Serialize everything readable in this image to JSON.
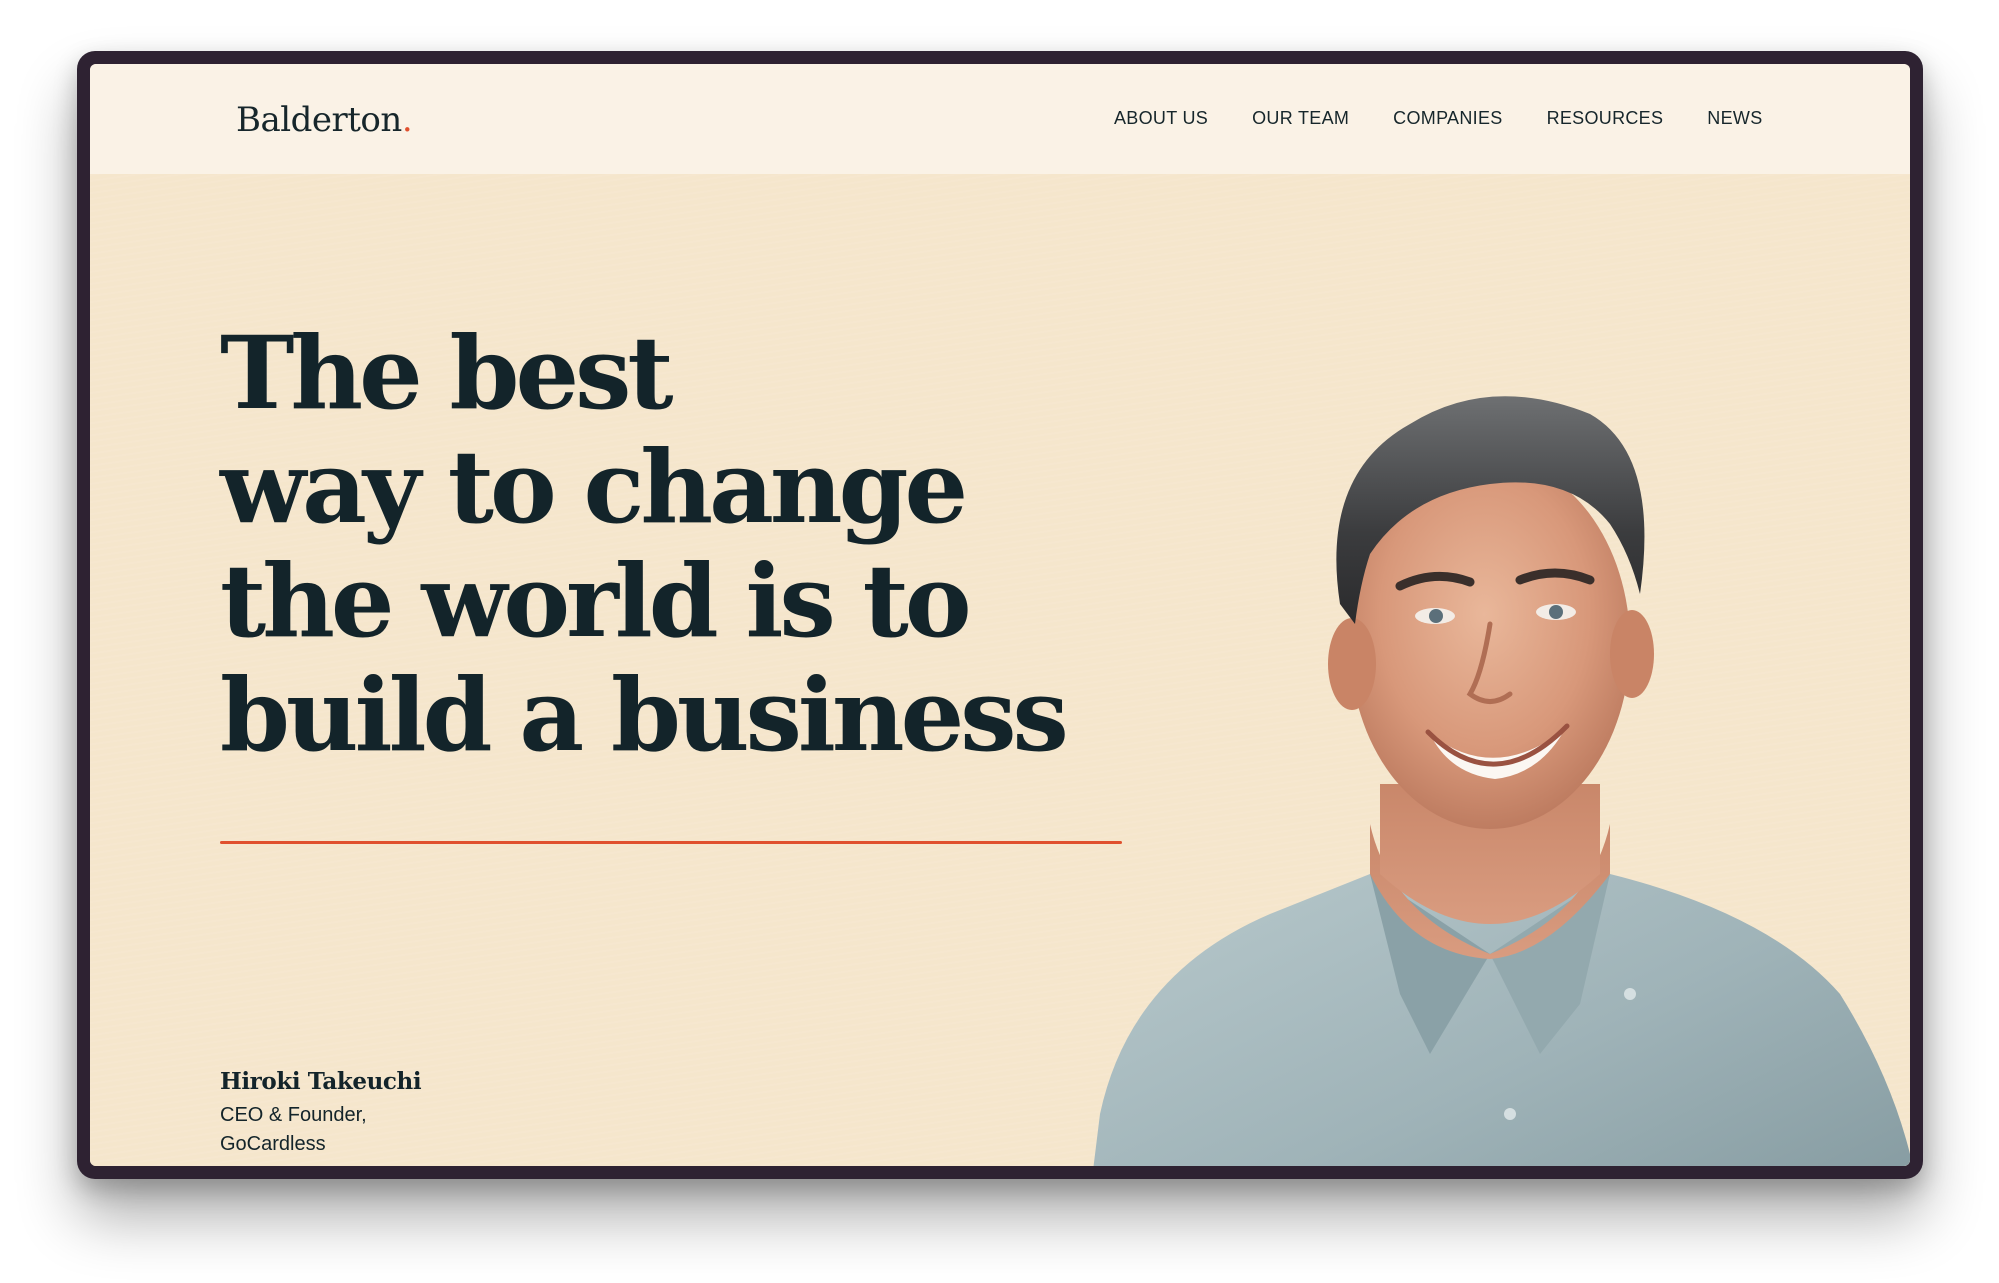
{
  "brand": {
    "logo_text": "Balderton",
    "logo_dot": ".",
    "accent_color": "#e0502e",
    "background_color": "#f5e6cc",
    "nav_background_color": "#faf2e6",
    "text_color": "#13242a"
  },
  "nav": {
    "items": [
      {
        "label": "ABOUT US"
      },
      {
        "label": "OUR TEAM"
      },
      {
        "label": "COMPANIES"
      },
      {
        "label": "RESOURCES"
      },
      {
        "label": "NEWS"
      }
    ]
  },
  "hero": {
    "headline_lines": [
      "The best",
      "way to change",
      "the world is to",
      "build a business"
    ],
    "person": {
      "name": "Hiroki Takeuchi",
      "role_line_1": "CEO & Founder,",
      "role_line_2": "GoCardless"
    },
    "portrait_icon": "founder-portrait-photo"
  }
}
